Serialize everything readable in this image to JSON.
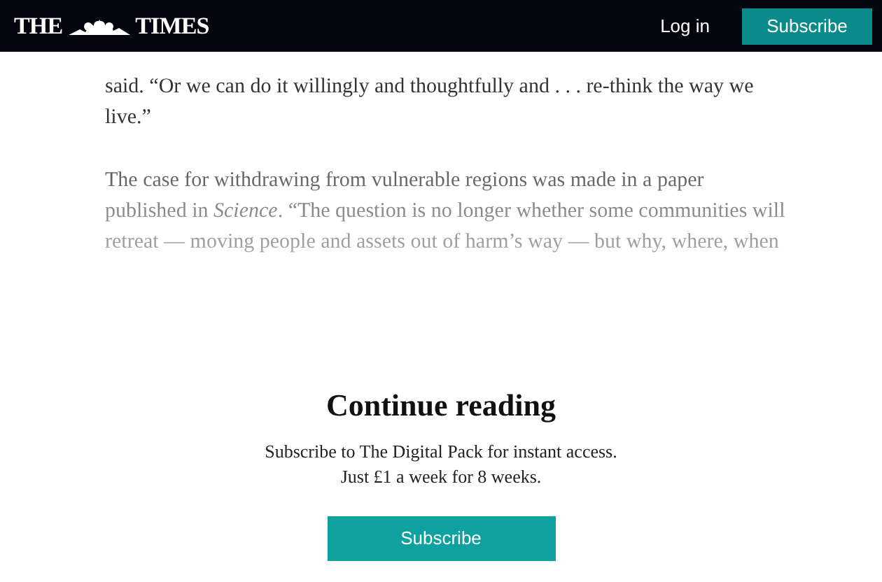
{
  "header": {
    "logo": [
      "THE",
      "TIMES"
    ],
    "login": "Log in",
    "subscribe": "Subscribe"
  },
  "article": {
    "paragraphs": [
      "said. “Or we can do it willingly and thoughtfully and . . . re-think the way we live.”",
      "The case for withdrawing from vulnerable regions was made in a paper published in *Science*. “The question is no longer whether some communities will retreat — moving people and assets out of harm’s way — but why, where, when"
    ]
  },
  "paywall": {
    "title": "Continue reading",
    "lines": [
      "Subscribe to The Digital Pack for instant access.",
      "Just £1 a week for 8 weeks."
    ],
    "button": "Subscribe"
  }
}
